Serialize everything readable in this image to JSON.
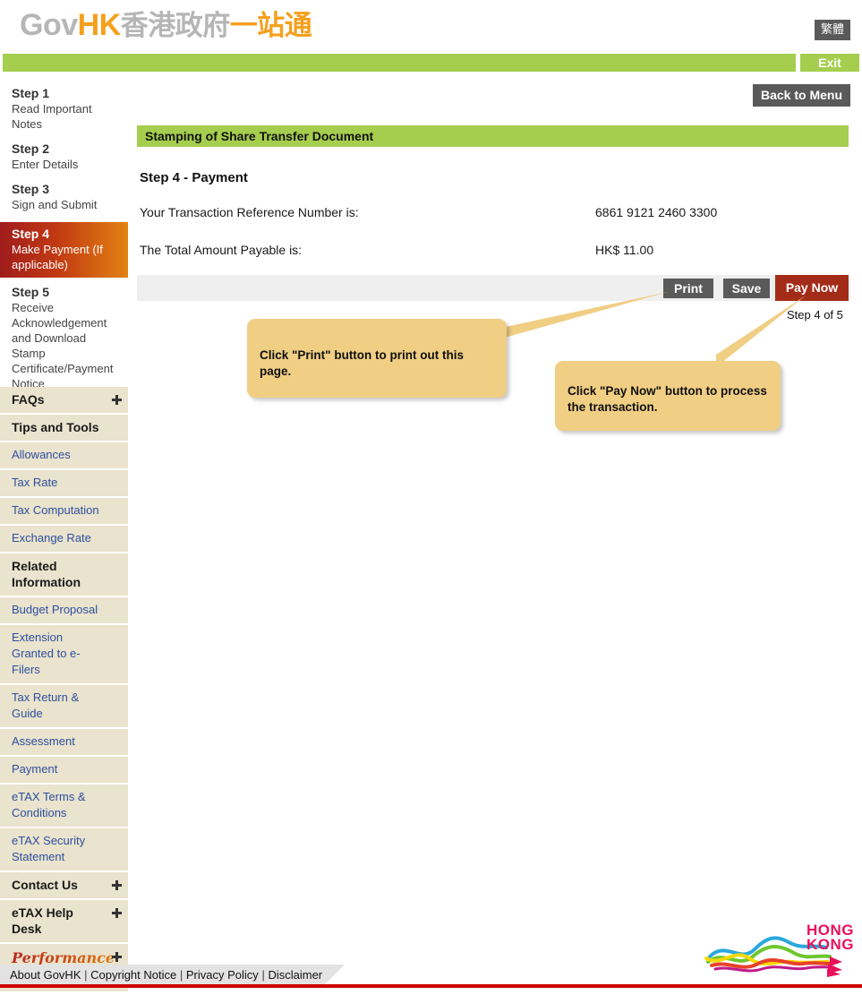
{
  "header": {
    "brand_gov": "Gov",
    "brand_hk": "HK",
    "brand_cn_gray": "香港政府",
    "brand_cn_orange": "一站通",
    "lang_toggle": "繁體",
    "exit_label": "Exit",
    "back_to_menu_label": "Back to Menu"
  },
  "sidebar": {
    "steps": [
      {
        "title": "Step 1",
        "sub": "Read Important Notes",
        "active": false
      },
      {
        "title": "Step 2",
        "sub": "Enter Details",
        "active": false
      },
      {
        "title": "Step 3",
        "sub": "Sign and Submit",
        "active": false
      },
      {
        "title": "Step 4",
        "sub": "Make Payment (If applicable)",
        "active": true
      },
      {
        "title": "Step 5",
        "sub": "Receive Acknowledgement and Download Stamp Certificate/Payment Notice",
        "active": false
      }
    ],
    "nav": [
      {
        "label": "FAQs",
        "type": "head",
        "expandable": true
      },
      {
        "label": "Tips and Tools",
        "type": "head",
        "expandable": false
      },
      {
        "label": "Allowances",
        "type": "link",
        "expandable": false
      },
      {
        "label": "Tax Rate",
        "type": "link",
        "expandable": false
      },
      {
        "label": "Tax Computation",
        "type": "link",
        "expandable": false
      },
      {
        "label": "Exchange Rate",
        "type": "link",
        "expandable": false
      },
      {
        "label": "Related Information",
        "type": "head",
        "expandable": false
      },
      {
        "label": "Budget Proposal",
        "type": "link",
        "expandable": false
      },
      {
        "label": "Extension Granted to e-Filers",
        "type": "link",
        "expandable": false
      },
      {
        "label": "Tax Return & Guide",
        "type": "link",
        "expandable": false
      },
      {
        "label": "Assessment",
        "type": "link",
        "expandable": false
      },
      {
        "label": "Payment",
        "type": "link",
        "expandable": false
      },
      {
        "label": "eTAX Terms & Conditions",
        "type": "link",
        "expandable": false
      },
      {
        "label": "eTAX Security Statement",
        "type": "link",
        "expandable": false
      },
      {
        "label": "Contact Us",
        "type": "head",
        "expandable": true
      },
      {
        "label": "eTAX Help Desk",
        "type": "head",
        "expandable": true
      },
      {
        "label": "Performance Pledge",
        "type": "pledge",
        "expandable": true
      }
    ]
  },
  "main": {
    "section_title": "Stamping of Share Transfer Document",
    "step_heading": "Step 4 - Payment",
    "fields": [
      {
        "label": "Your Transaction Reference Number is:",
        "value": "6861 9121 2460 3300"
      },
      {
        "label": "The Total Amount Payable is:",
        "value": "HK$  11.00"
      }
    ],
    "buttons": {
      "print": "Print",
      "save": "Save",
      "pay_now": "Pay Now"
    },
    "step_counter": "Step 4 of 5"
  },
  "callouts": [
    {
      "text": "Click \"Print\" button to print out this page."
    },
    {
      "text": "Click \"Pay Now\" button to process the transaction."
    }
  ],
  "footer": {
    "links": [
      "About GovHK",
      "Copyright Notice",
      "Privacy Policy",
      "Disclaimer"
    ],
    "separator": "|",
    "logo_line1": "HONG",
    "logo_line2": "KONG"
  },
  "colors": {
    "green": "#a5ce4e",
    "accent_red": "#a32c18",
    "gray_button": "#5a5a5a",
    "sidebar_bg": "#eae3cd",
    "callout_bg": "#f0ce84",
    "link_blue": "#2c4fa0",
    "footer_rule": "#cc0000"
  }
}
